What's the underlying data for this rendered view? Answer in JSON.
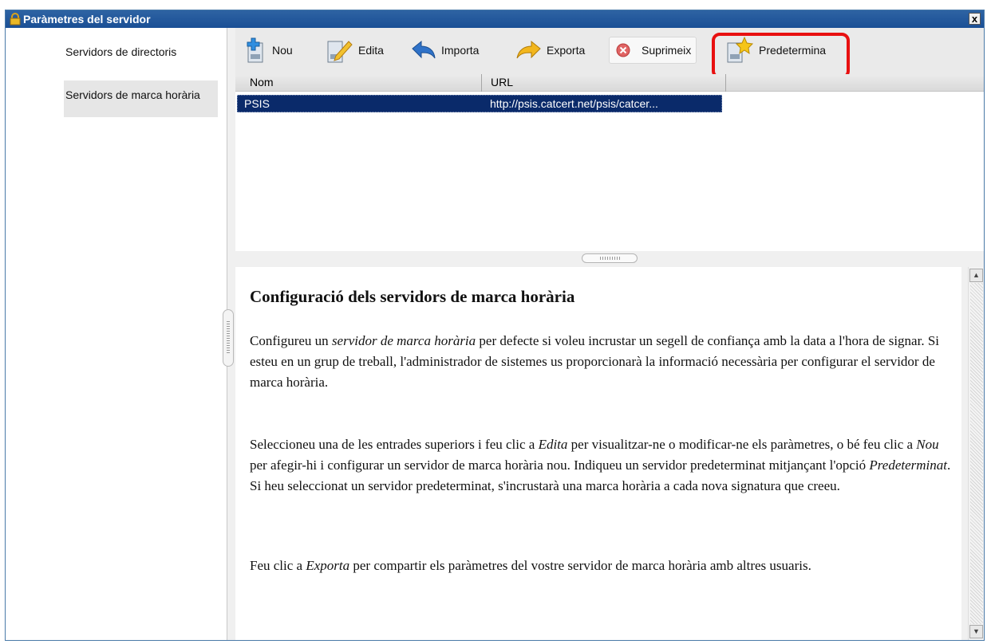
{
  "window": {
    "title": "Paràmetres del servidor",
    "close_label": "x"
  },
  "sidebar": {
    "items": [
      {
        "label": "Servidors de directoris",
        "selected": false
      },
      {
        "label": "Servidors de marca horària",
        "selected": true
      }
    ]
  },
  "toolbar": {
    "buttons": [
      {
        "label": "Nou",
        "icon": "new-server-icon"
      },
      {
        "label": "Edita",
        "icon": "edit-pencil-icon"
      },
      {
        "label": "Importa",
        "icon": "import-arrow-icon"
      },
      {
        "label": "Exporta",
        "icon": "export-arrow-icon"
      },
      {
        "label": "Suprimeix",
        "icon": "delete-icon"
      },
      {
        "label": "Predetermina",
        "icon": "set-default-star-icon"
      }
    ]
  },
  "table": {
    "columns": [
      "Nom",
      "URL"
    ],
    "rows": [
      {
        "name": "PSIS",
        "url": "http://psis.catcert.net/psis/catcer..."
      }
    ]
  },
  "help": {
    "heading": "Configuració dels servidors de marca horària",
    "p1": {
      "a": "Configureu un ",
      "em1": "servidor de marca horària",
      "b": " per defecte si voleu incrustar un segell de confiança amb la data a l'hora de signar. Si esteu en un grup de treball, l'administrador de sistemes us proporcionarà la informació necessària per configurar el servidor de marca horària."
    },
    "p2": {
      "a": "Seleccioneu una de les entrades superiors i feu clic a ",
      "em1": "Edita",
      "b": " per visualitzar-ne o modificar-ne els paràmetres, o bé feu clic a ",
      "em2": "Nou",
      "c": " per afegir-hi i configurar un servidor de marca horària nou. Indiqueu un servidor predeterminat mitjançant l'opció ",
      "em3": "Predeterminat",
      "d": ". Si heu seleccionat un servidor predeterminat, s'incrustarà una marca horària a cada nova signatura que creeu."
    },
    "p3": {
      "a": "Feu clic a ",
      "em1": "Exporta",
      "b": " per compartir els paràmetres del vostre servidor de marca horària amb altres usuaris."
    }
  },
  "colors": {
    "titlebar": "#1a4f95",
    "selection": "#0a2a6a",
    "highlight": "#e81010"
  }
}
